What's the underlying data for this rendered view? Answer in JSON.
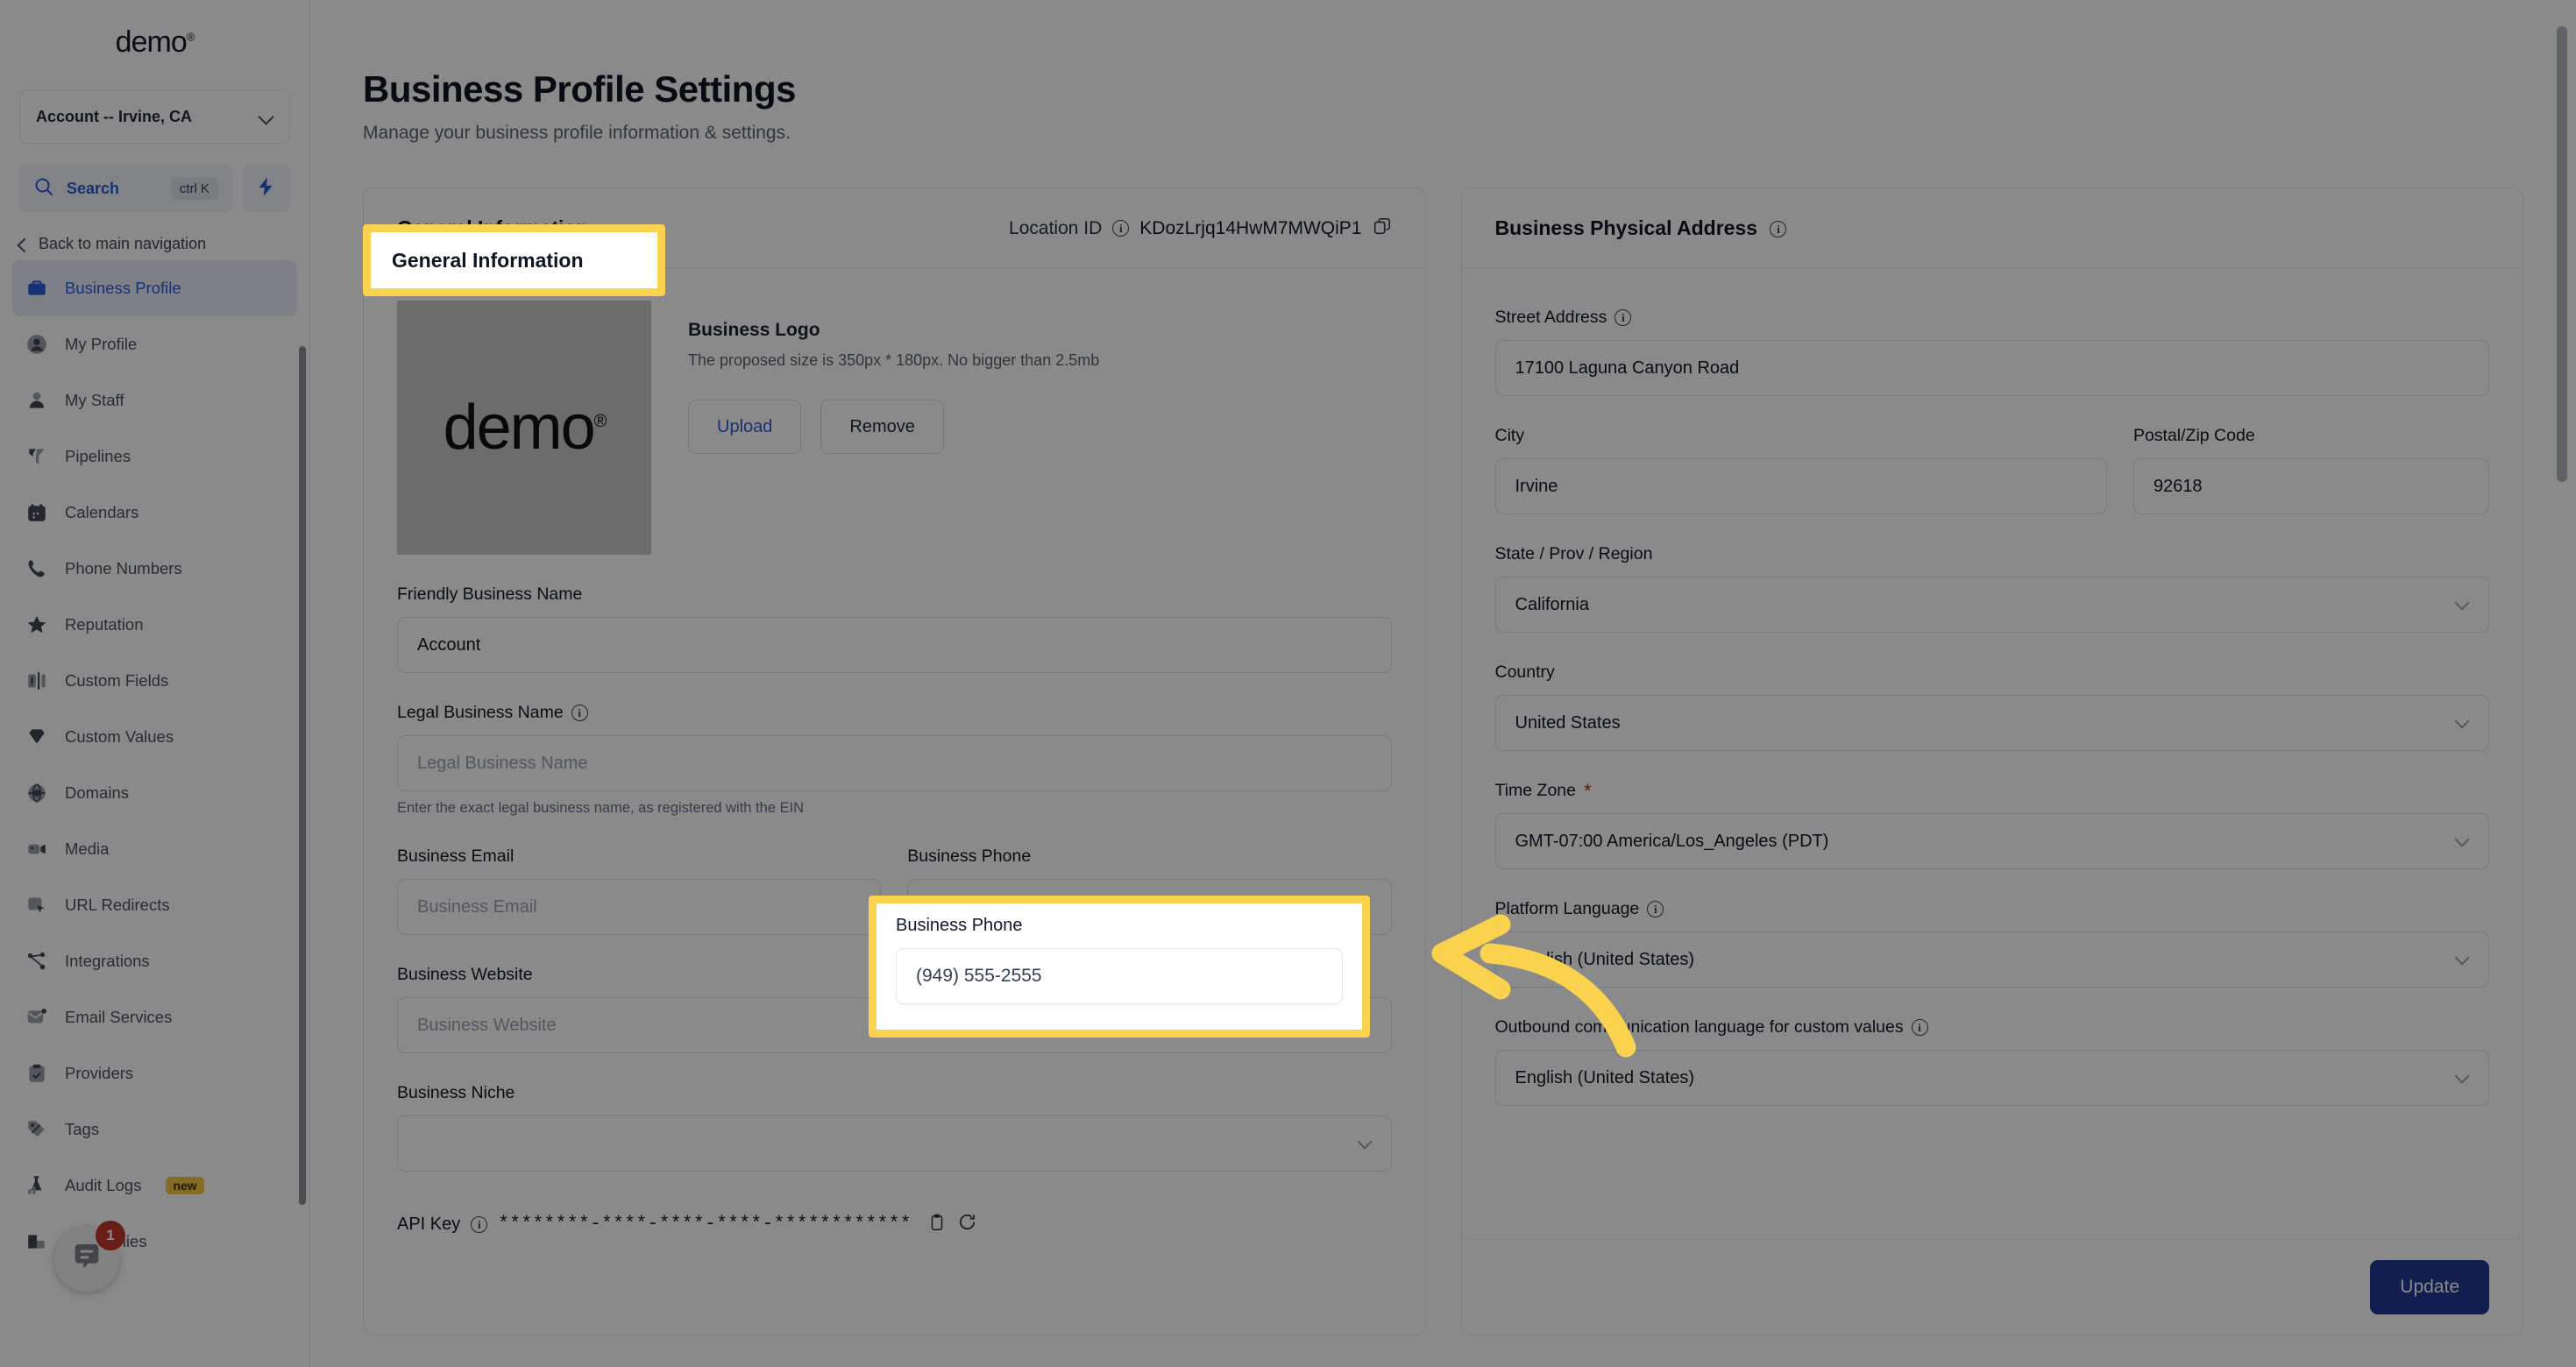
{
  "sidebar": {
    "brand": "demo",
    "brand_mark": "®",
    "account_selector": "Account -- Irvine, CA",
    "search": {
      "label": "Search",
      "shortcut": "ctrl K"
    },
    "back_nav": "Back to main navigation",
    "items": [
      {
        "label": "Business Profile",
        "icon": "briefcase-icon",
        "active": true
      },
      {
        "label": "My Profile",
        "icon": "user-circle-icon",
        "active": false
      },
      {
        "label": "My Staff",
        "icon": "user-icon",
        "active": false
      },
      {
        "label": "Pipelines",
        "icon": "funnel-icon",
        "active": false
      },
      {
        "label": "Calendars",
        "icon": "calendar-icon",
        "active": false
      },
      {
        "label": "Phone Numbers",
        "icon": "phone-icon",
        "active": false
      },
      {
        "label": "Reputation",
        "icon": "star-icon",
        "active": false
      },
      {
        "label": "Custom Fields",
        "icon": "fields-icon",
        "active": false
      },
      {
        "label": "Custom Values",
        "icon": "gem-icon",
        "active": false
      },
      {
        "label": "Domains",
        "icon": "globe-icon",
        "active": false
      },
      {
        "label": "Media",
        "icon": "video-icon",
        "active": false
      },
      {
        "label": "URL Redirects",
        "icon": "cursor-box-icon",
        "active": false
      },
      {
        "label": "Integrations",
        "icon": "share-nodes-icon",
        "active": false
      },
      {
        "label": "Email Services",
        "icon": "envelope-icon",
        "active": false
      },
      {
        "label": "Providers",
        "icon": "clipboard-check-icon",
        "active": false
      },
      {
        "label": "Tags",
        "icon": "tag-icon",
        "active": false
      },
      {
        "label": "Audit Logs",
        "icon": "lab-chart-icon",
        "active": false,
        "badge": "new"
      },
      {
        "label": "Companies",
        "icon": "building-icon",
        "active": false
      }
    ],
    "chat_widget": {
      "unread_count": "1"
    }
  },
  "header": {
    "title": "Business Profile Settings",
    "subtitle": "Manage your business profile information & settings."
  },
  "general": {
    "card_title": "General Information",
    "location_id_label": "Location ID",
    "location_id_value": "KDozLrjq14HwM7MWQiP1",
    "copy_icon": "copy-icon",
    "logo": {
      "image_text": "demo",
      "image_mark": "®",
      "title": "Business Logo",
      "hint": "The proposed size is 350px * 180px. No bigger than 2.5mb",
      "upload_label": "Upload",
      "remove_label": "Remove"
    },
    "fields": {
      "friendly_name": {
        "label": "Friendly Business Name",
        "value": "Account"
      },
      "legal_name": {
        "label": "Legal Business Name",
        "placeholder": "Legal Business Name",
        "hint": "Enter the exact legal business name, as registered with the EIN"
      },
      "business_email": {
        "label": "Business Email",
        "placeholder": "Business Email"
      },
      "business_phone": {
        "label": "Business Phone",
        "value": "(949) 555-2555"
      },
      "business_website": {
        "label": "Business Website",
        "placeholder": "Business Website"
      },
      "business_niche": {
        "label": "Business Niche",
        "value": ""
      }
    },
    "api_key": {
      "label": "API Key",
      "value": "********-****-****-****-************",
      "copy_icon": "copy-icon",
      "refresh_icon": "refresh-icon"
    }
  },
  "address": {
    "card_title": "Business Physical Address",
    "street": {
      "label": "Street Address",
      "value": "17100 Laguna Canyon Road"
    },
    "city": {
      "label": "City",
      "value": "Irvine"
    },
    "postal": {
      "label": "Postal/Zip Code",
      "value": "92618"
    },
    "state": {
      "label": "State / Prov / Region",
      "value": "California"
    },
    "country": {
      "label": "Country",
      "value": "United States"
    },
    "timezone": {
      "label": "Time Zone",
      "required": "*",
      "value": "GMT-07:00 America/Los_Angeles (PDT)"
    },
    "platform_language": {
      "label": "Platform Language",
      "value": "English (United States)"
    },
    "outbound_language": {
      "label": "Outbound communication language for custom values",
      "value": "English (United States)"
    },
    "update_label": "Update"
  },
  "colors": {
    "accent_blue": "#2b5bd7",
    "primary_button": "#1f3a93",
    "highlight_yellow": "#fbd24e",
    "badge_red": "#c0392b",
    "badge_new": "#f4c744"
  }
}
